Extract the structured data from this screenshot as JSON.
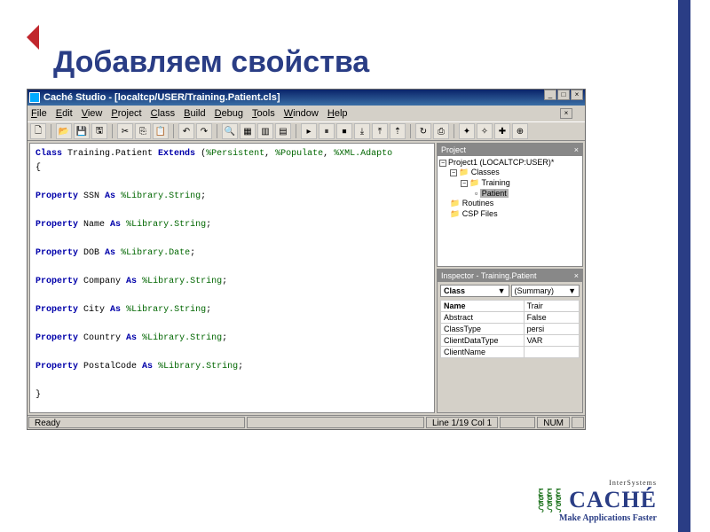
{
  "slide": {
    "title": "Добавляем свойства"
  },
  "window": {
    "title": "Caché Studio - [localtcp/USER/Training.Patient.cls]",
    "menus": [
      "File",
      "Edit",
      "View",
      "Project",
      "Class",
      "Build",
      "Debug",
      "Tools",
      "Window",
      "Help"
    ],
    "status": {
      "ready": "Ready",
      "linecol": "Line 1/19 Col 1",
      "num": "NUM"
    }
  },
  "code": {
    "classDecl": "Class Training.Patient Extends (%Persistent, %Populate, %XML.Adapto",
    "properties": [
      {
        "name": "SSN",
        "type": "%Library.String"
      },
      {
        "name": "Name",
        "type": "%Library.String"
      },
      {
        "name": "DOB",
        "type": "%Library.Date"
      },
      {
        "name": "Company",
        "type": "%Library.String"
      },
      {
        "name": "City",
        "type": "%Library.String"
      },
      {
        "name": "Country",
        "type": "%Library.String"
      },
      {
        "name": "PostalCode",
        "type": "%Library.String"
      }
    ]
  },
  "projectPanel": {
    "title": "Project",
    "root": "Project1 (LOCALTCP:USER)*",
    "folders": {
      "classes": "Classes",
      "training": "Training",
      "patient": "Patient",
      "routines": "Routines",
      "csp": "CSP Files"
    }
  },
  "inspectorPanel": {
    "title": "Inspector - Training.Patient",
    "dropdown1": "Class",
    "dropdown2": "(Summary)",
    "rows": [
      {
        "k": "Name",
        "v": "Trair"
      },
      {
        "k": "Abstract",
        "v": "False"
      },
      {
        "k": "ClassType",
        "v": "persi"
      },
      {
        "k": "ClientDataType",
        "v": "VAR"
      },
      {
        "k": "ClientName",
        "v": ""
      }
    ]
  },
  "logo": {
    "upper": "InterSystems",
    "brand": "CACHÉ",
    "tag": "Make Applications Faster"
  },
  "icons": {
    "min": "_",
    "max": "□",
    "close": "×",
    "dd": "▼",
    "plus": "+",
    "minus": "−"
  },
  "toolbar_icons": [
    "□",
    "▸",
    "▦",
    "▤",
    "✂",
    "⎘",
    "📋",
    "↶",
    "↷",
    "🔍",
    "▣",
    "▦",
    "▥",
    "▤",
    "▸",
    "⏸",
    "⏹",
    "⤓",
    "⤒",
    "◧",
    "↻",
    "⊞",
    "⎙"
  ]
}
